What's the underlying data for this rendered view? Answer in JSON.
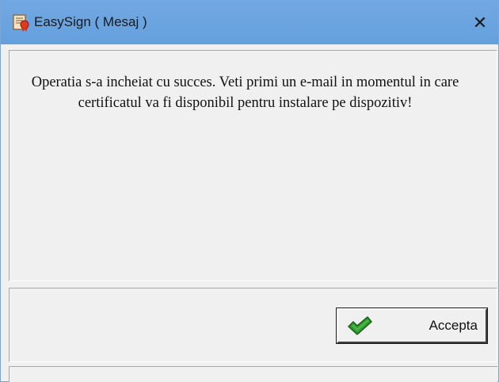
{
  "window": {
    "title": "EasySign ( Mesaj )",
    "close_glyph": "✕",
    "app_icon": "certificate-ribbon-icon"
  },
  "content": {
    "message": "Operatia s-a incheiat cu succes. Veti primi un e-mail in momentul in care certificatul va fi disponibil pentru instalare pe dispozitiv!"
  },
  "buttons": {
    "accept_label": "Accepta",
    "accept_icon": "green-checkmark-icon"
  },
  "colors": {
    "titlebar": "#6aa0dc",
    "window_bg": "#f0f0f0",
    "check_green": "#2e9a2e"
  }
}
